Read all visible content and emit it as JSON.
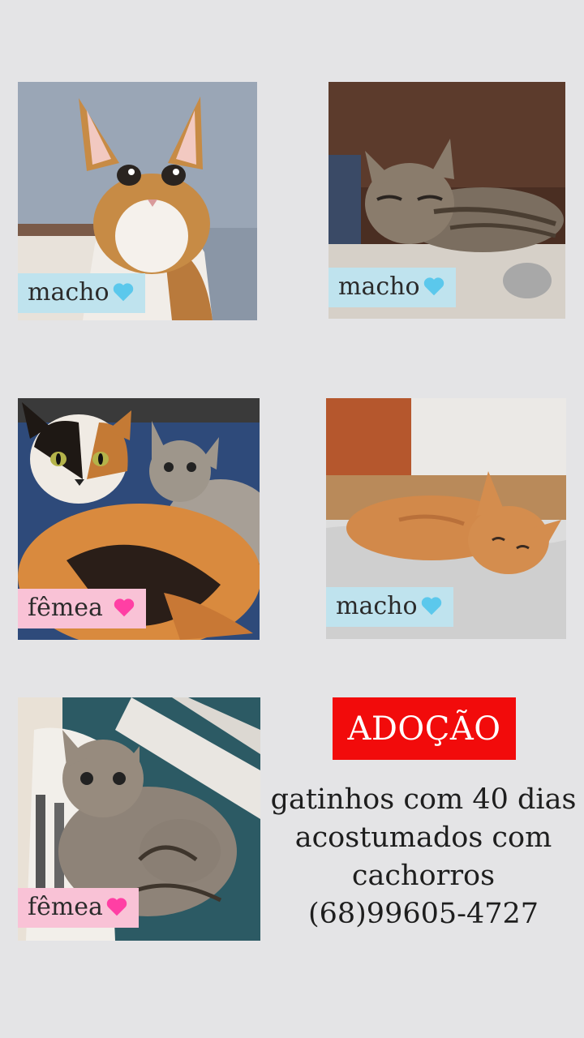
{
  "photos": [
    {
      "tag": "macho",
      "heart": "blue-heart-icon",
      "tag_color": "#bfe3ee",
      "heart_color": "#5bc8ec"
    },
    {
      "tag": "macho",
      "heart": "blue-heart-icon",
      "tag_color": "#bfe3ee",
      "heart_color": "#5bc8ec"
    },
    {
      "tag": "fêmea ",
      "heart": "pink-heart-icon",
      "tag_color": "#f9c2d6",
      "heart_color": "#ff3fa4"
    },
    {
      "tag": "macho",
      "heart": "blue-heart-icon",
      "tag_color": "#bfe3ee",
      "heart_color": "#5bc8ec"
    },
    {
      "tag": "fêmea",
      "heart": "pink-heart-icon",
      "tag_color": "#f9c2d6",
      "heart_color": "#ff3fa4"
    }
  ],
  "banner": {
    "title": "ADOÇÃO",
    "color": "#f20b0b"
  },
  "info": {
    "line1": "gatinhos com 40 dias",
    "line2": "acostumados com",
    "line3": "cachorros",
    "phone": "(68)99605-4727"
  }
}
